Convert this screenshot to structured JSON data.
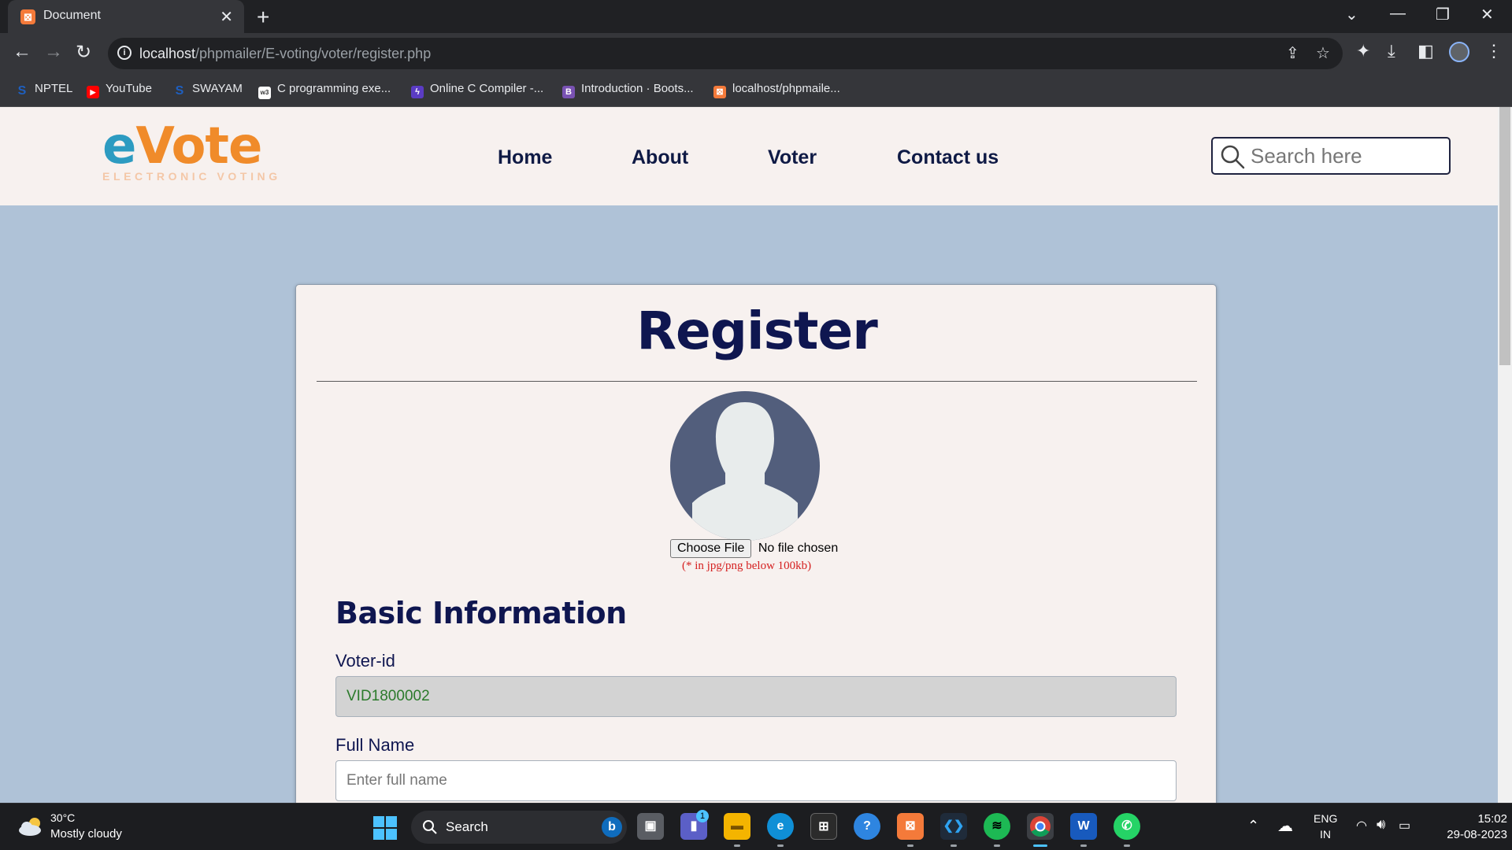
{
  "browser": {
    "tab_title": "Document",
    "url_host": "localhost",
    "url_path": "/phpmailer/E-voting/voter/register.php",
    "bookmarks": [
      {
        "label": "NPTEL",
        "icon": "swayam-s-icon",
        "color": "#1e5fbf"
      },
      {
        "label": "YouTube",
        "icon": "youtube-icon",
        "color": "#ff0000"
      },
      {
        "label": "SWAYAM",
        "icon": "swayam-s-icon",
        "color": "#1e5fbf"
      },
      {
        "label": "C programming exe...",
        "icon": "w3schools-icon",
        "color": "#ffffff"
      },
      {
        "label": "Online C Compiler -...",
        "icon": "bolt-icon",
        "color": "#5b3cc4"
      },
      {
        "label": "Introduction · Boots...",
        "icon": "bootstrap-icon",
        "color": "#7952b3"
      },
      {
        "label": "localhost/phpmaile...",
        "icon": "xampp-icon",
        "color": "#f47a3a"
      }
    ]
  },
  "site": {
    "logo_word_e": "e",
    "logo_word_rest": "Vote",
    "logo_tagline": "ELECTRONIC VOTING",
    "nav": [
      "Home",
      "About",
      "Voter",
      "Contact us"
    ],
    "search_placeholder": "Search here"
  },
  "form": {
    "title": "Register",
    "file_button": "Choose File",
    "file_status": "No file chosen",
    "file_hint": "(* in jpg/png below 100kb)",
    "section_title": "Basic Information",
    "voter_id_label": "Voter-id",
    "voter_id_value": "VID1800002",
    "fullname_label": "Full Name",
    "fullname_placeholder": "Enter full name"
  },
  "taskbar": {
    "weather_temp": "30°C",
    "weather_desc": "Mostly cloudy",
    "search_label": "Search",
    "lang_top": "ENG",
    "lang_bottom": "IN",
    "time": "15:02",
    "date": "29-08-2023",
    "teams_badge": "1"
  },
  "colors": {
    "page_bg": "#afc2d7",
    "header_bg": "#f7f1ef",
    "heading_navy": "#0f1650",
    "hint_red": "#d52020",
    "voter_id_green": "#2b7a2b"
  }
}
